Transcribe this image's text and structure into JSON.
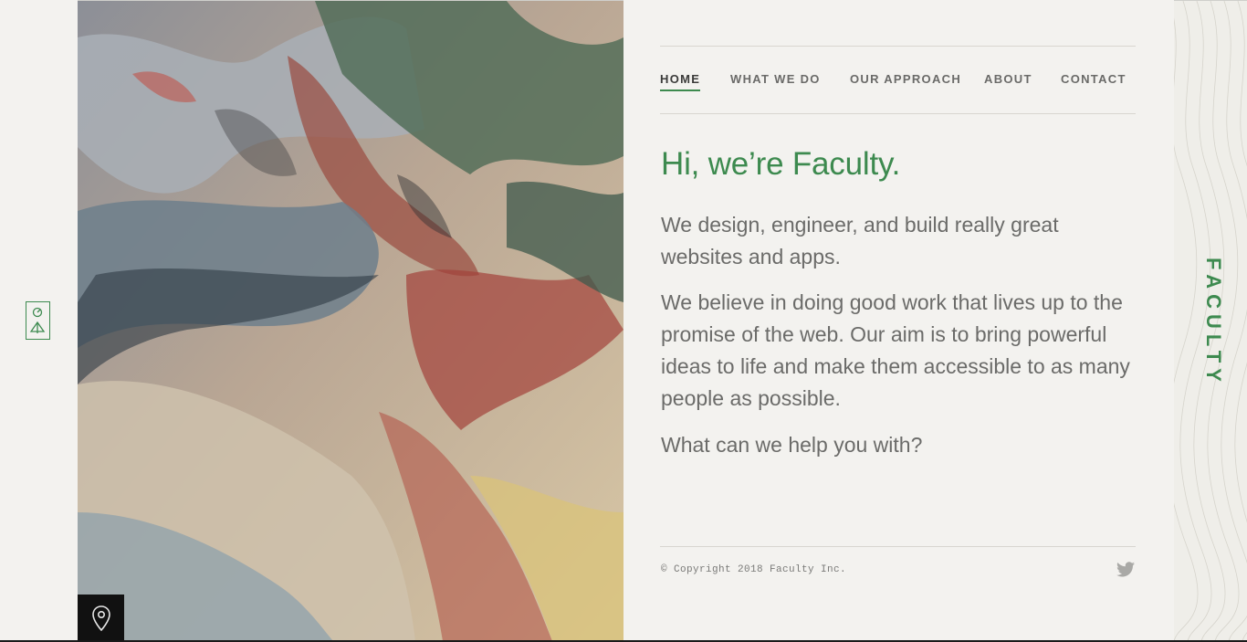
{
  "nav": {
    "items": [
      {
        "label": "HOME",
        "active": true
      },
      {
        "label": "WHAT WE DO",
        "active": false
      },
      {
        "label": "OUR APPROACH",
        "active": false
      },
      {
        "label": "ABOUT",
        "active": false
      },
      {
        "label": "CONTACT",
        "active": false
      }
    ]
  },
  "main": {
    "headline": "Hi, we’re Faculty.",
    "paragraph_1": "We design, engineer, and build really great websites and apps.",
    "paragraph_2": "We believe in doing good work that lives up to the promise of the web. Our aim is to bring powerful ideas to life and make them accessible to as many people as possible.",
    "paragraph_3": "What can we help you with?"
  },
  "footer": {
    "copyright": "© Copyright 2018 Faculty Inc.",
    "social_icon": "twitter-icon"
  },
  "brand": {
    "wordmark": "FACULTY"
  },
  "icons": {
    "logo": "faculty-logo-icon",
    "location": "map-pin-icon"
  },
  "colors": {
    "accent": "#3d8a4f",
    "background": "#f3f2ef",
    "text": "#6b6b69"
  }
}
